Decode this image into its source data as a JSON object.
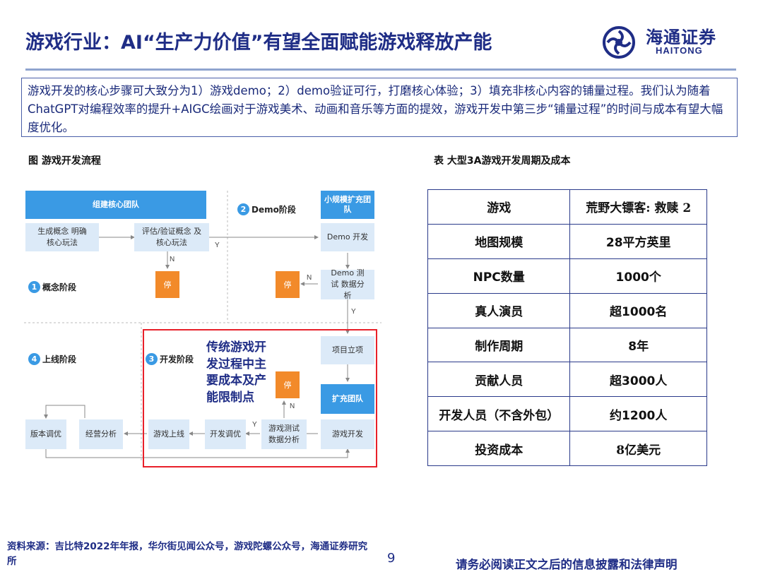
{
  "header": {
    "title": "游戏行业：AI“生产力价值”有望全面赋能游戏释放产能",
    "logo_cn": "海通证券",
    "logo_en": "HAITONG"
  },
  "summary": "游戏开发的核心步骤可大致分为1）游戏demo；2）demo验证可行，打磨核心体验；3）填充非核心内容的铺量过程。我们认为随着ChatGPT对编程效率的提升+AIGC绘画对于游戏美术、动画和音乐等方面的提效，游戏开发中第三步“铺量过程”的时间与成本有望大幅度优化。",
  "figure": {
    "title": "图  游戏开发流程",
    "band_core": "组建核心团队",
    "band_small": "小规模扩充团队",
    "band_expand": "扩充团队",
    "stage1": "概念阶段",
    "stage2": "Demo阶段",
    "stage3": "开发阶段",
    "stage4": "上线阶段",
    "n1": "1",
    "n2": "2",
    "n3": "3",
    "n4": "4",
    "box_concept": "生成概念 明确核心玩法",
    "box_eval": "评估/验证概念 及核心玩法",
    "box_demo_dev": "Demo 开发",
    "box_demo_test": "Demo 测试 数据分析",
    "box_project": "项目立项",
    "box_game_dev": "游戏开发",
    "box_game_test": "游戏测试 数据分析",
    "box_tune": "开发调优",
    "box_launch": "游戏上线",
    "box_biz": "经营分析",
    "box_version": "版本调优",
    "stop": "停",
    "y": "Y",
    "n": "N",
    "annotation": "传统游戏开发过程中主要成本及产能限制点"
  },
  "table": {
    "title": "表  大型3A游戏开发周期及成本",
    "rows": [
      [
        "游戏",
        "荒野大镖客: 救赎 2"
      ],
      [
        "地图规模",
        "28平方英里"
      ],
      [
        "NPC数量",
        "1000个"
      ],
      [
        "真人演员",
        "超1000名"
      ],
      [
        "制作周期",
        "8年"
      ],
      [
        "贡献人员",
        "超3000人"
      ],
      [
        "开发人员（不含外包）",
        "约1200人"
      ],
      [
        "投资成本",
        "8亿美元"
      ]
    ]
  },
  "footer": {
    "source": "资料来源：吉比特2022年年报，华尔街见闻公众号，游戏陀螺公众号，海通证券研究所",
    "page": "9",
    "disclaimer": "请务必阅读正文之后的信息披露和法律声明"
  },
  "colors": {
    "navy": "#1f2d86",
    "flow_blue": "#3a9ae4",
    "light_box": "#dceaf8",
    "stop_orange": "#f28a2a",
    "highlight_red": "#e8202a"
  }
}
